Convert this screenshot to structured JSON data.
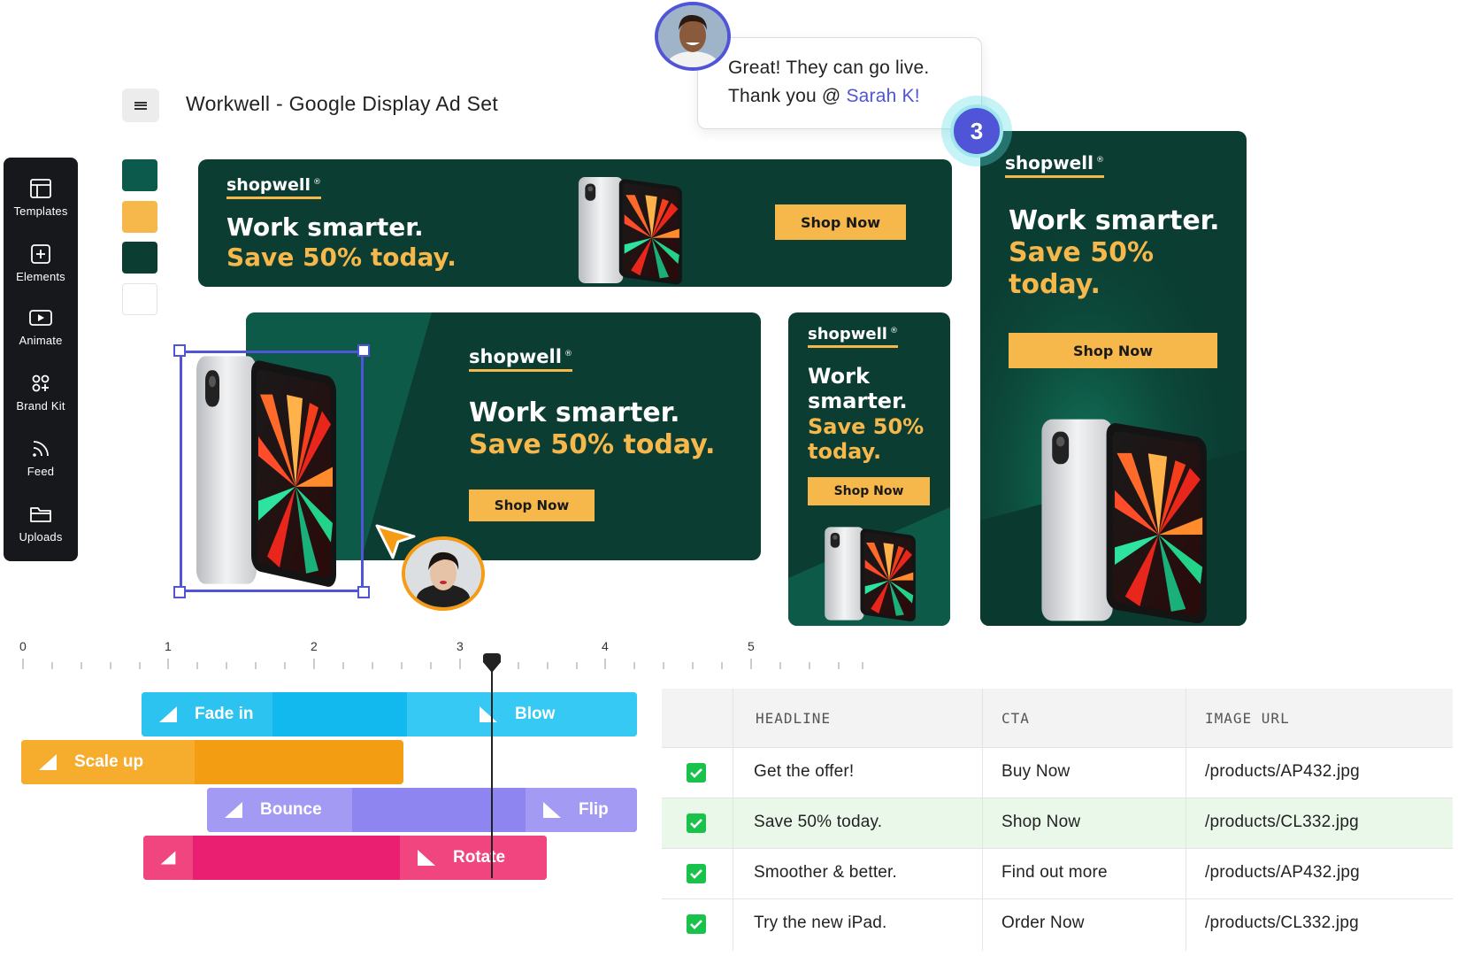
{
  "header": {
    "menu_icon": "hamburger-icon",
    "title": "Workwell - Google Display Ad Set"
  },
  "sidebar": {
    "items": [
      {
        "label": "Templates",
        "icon": "templates-icon"
      },
      {
        "label": "Elements",
        "icon": "plus-square-icon"
      },
      {
        "label": "Animate",
        "icon": "play-icon"
      },
      {
        "label": "Brand Kit",
        "icon": "brand-kit-icon"
      },
      {
        "label": "Feed",
        "icon": "feed-icon"
      },
      {
        "label": "Uploads",
        "icon": "folder-icon"
      }
    ]
  },
  "swatches": [
    "#0b5a4c",
    "#f6b74b",
    "#0b3d32",
    "#ffffff"
  ],
  "ads": {
    "brand": "shopwell",
    "registered": "®",
    "line1": "Work smarter.",
    "line2": "Save 50% today.",
    "narrow_line1a": "Work",
    "narrow_line1b": "smarter.",
    "narrow_line2a": "Save 50%",
    "narrow_line2b": "today.",
    "cta": "Shop Now",
    "colors": {
      "background": "#0b3d32",
      "accent": "#f6b74b"
    }
  },
  "comment": {
    "line1": "Great! They can go live.",
    "line2_prefix": "Thank you @ ",
    "mention": "Sarah K!",
    "badge_count": "3"
  },
  "timeline": {
    "ruler": [
      "0",
      "1",
      "2",
      "3",
      "4",
      "5"
    ],
    "tracks": [
      {
        "start_label": "Fade in",
        "end_label": "Blow",
        "color": "#12b9ee"
      },
      {
        "start_label": "Scale up",
        "color": "#f29d12"
      },
      {
        "start_label": "Bounce",
        "end_label": "Flip",
        "color": "#8f85f1"
      },
      {
        "start_label": "",
        "end_label": "Rotate",
        "color": "#ea1f72"
      }
    ]
  },
  "table": {
    "columns": [
      "HEADLINE",
      "CTA",
      "IMAGE URL"
    ],
    "rows": [
      {
        "headline": "Get the offer!",
        "cta": "Buy Now",
        "image_url": "/products/AP432.jpg",
        "checked": true,
        "highlighted": false
      },
      {
        "headline": "Save 50% today.",
        "cta": "Shop Now",
        "image_url": "/products/CL332.jpg",
        "checked": true,
        "highlighted": true
      },
      {
        "headline": "Smoother & better.",
        "cta": "Find out more",
        "image_url": "/products/AP432.jpg",
        "checked": true,
        "highlighted": false
      },
      {
        "headline": "Try the new iPad.",
        "cta": "Order Now",
        "image_url": "/products/CL332.jpg",
        "checked": true,
        "highlighted": false
      }
    ]
  }
}
